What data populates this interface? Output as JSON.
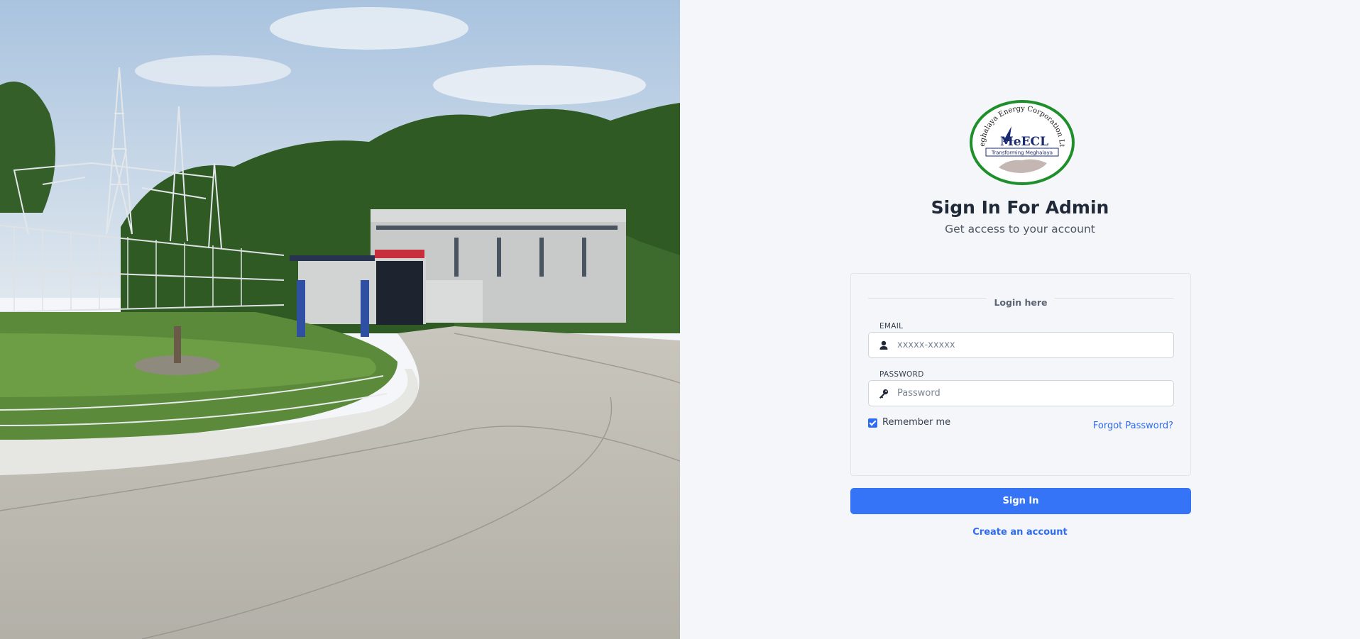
{
  "photo": {
    "alt": "MeECL power station photo"
  },
  "logo": {
    "arc_text": "Meghalaya Energy Corporation Ltd.",
    "abbr": "MeECL",
    "tagline": "Transforming Meghalaya",
    "ring_color": "#1e8f2a"
  },
  "page": {
    "title": "Sign In For Admin",
    "subtitle": "Get access to your account"
  },
  "form": {
    "section_label": "Login here",
    "email": {
      "label": "EMAIL",
      "placeholder": "xxxxx-xxxxx",
      "value": "",
      "icon": "user-icon"
    },
    "password": {
      "label": "PASSWORD",
      "placeholder": "Password",
      "value": "",
      "icon": "key-icon"
    },
    "remember": {
      "label": "Remember me",
      "checked": true
    },
    "forgot_label": "Forgot Password?"
  },
  "actions": {
    "sign_in_label": "Sign In",
    "create_account_label": "Create an account"
  },
  "colors": {
    "accent": "#3574f6",
    "background": "#f4f6f9"
  }
}
